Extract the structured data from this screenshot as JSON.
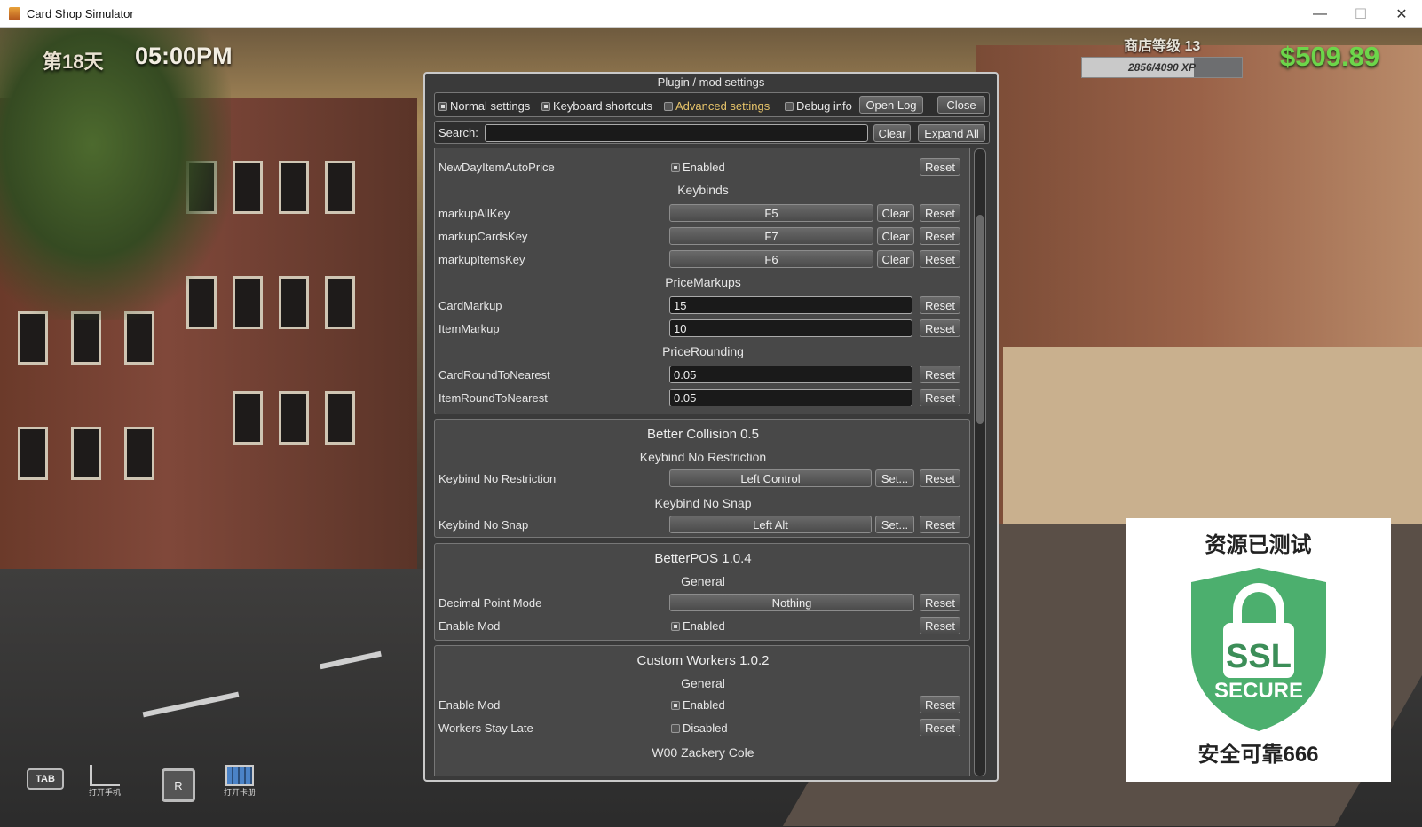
{
  "window": {
    "title": "Card Shop Simulator",
    "minimize": "—",
    "maximize": "☐",
    "close": "✕"
  },
  "hud": {
    "day": "第18天",
    "time": "05:00PM",
    "shop_level": "商店等级 13",
    "xp_text": "2856/4090 XP",
    "xp_fraction": 0.698,
    "money": "$509.89",
    "tab_key": "TAB",
    "phone_label": "打开手机",
    "r_key": "R",
    "album_label": "打开卡册"
  },
  "dialog": {
    "title": "Plugin / mod settings",
    "tabs": [
      {
        "label": "Normal settings",
        "checked": true
      },
      {
        "label": "Keyboard shortcuts",
        "checked": true
      },
      {
        "label": "Advanced settings",
        "checked": false
      },
      {
        "label": "Debug info",
        "checked": false
      }
    ],
    "open_log": "Open Log",
    "close": "Close",
    "search_label": "Search:",
    "search_value": "",
    "clear": "Clear",
    "expand_all": "Expand All",
    "reset": "Reset",
    "set": "Set...",
    "enabled": "Enabled",
    "disabled": "Disabled"
  },
  "settings": {
    "newday": {
      "label": "NewDayItemAutoPrice",
      "value": "Enabled"
    },
    "keybinds": {
      "title": "Keybinds",
      "items": [
        {
          "label": "markupAllKey",
          "value": "F5"
        },
        {
          "label": "markupCardsKey",
          "value": "F7"
        },
        {
          "label": "markupItemsKey",
          "value": "F6"
        }
      ]
    },
    "price_markups": {
      "title": "PriceMarkups",
      "items": [
        {
          "label": "CardMarkup",
          "value": "15"
        },
        {
          "label": "ItemMarkup",
          "value": "10"
        }
      ]
    },
    "price_rounding": {
      "title": "PriceRounding",
      "items": [
        {
          "label": "CardRoundToNearest",
          "value": "0.05"
        },
        {
          "label": "ItemRoundToNearest",
          "value": "0.05"
        }
      ]
    },
    "better_collision": {
      "title": "Better Collision 0.5",
      "sections": [
        {
          "title": "Keybind No Restriction",
          "label": "Keybind No Restriction",
          "value": "Left Control"
        },
        {
          "title": "Keybind No Snap",
          "label": "Keybind No Snap",
          "value": "Left Alt"
        }
      ]
    },
    "better_pos": {
      "title": "BetterPOS 1.0.4",
      "section": "General",
      "decimal_label": "Decimal Point Mode",
      "decimal_value": "Nothing",
      "enable_label": "Enable Mod",
      "enable_value": "Enabled"
    },
    "custom_workers": {
      "title": "Custom Workers 1.0.2",
      "section": "General",
      "enable_label": "Enable Mod",
      "enable_value": "Enabled",
      "stay_late_label": "Workers Stay Late",
      "stay_late_value": "Disabled",
      "next_section": "W00 Zackery Cole"
    }
  },
  "watermark": {
    "top": "资源已测试",
    "shield_top": "SSL",
    "shield_bottom": "SECURE",
    "bottom": "安全可靠666"
  }
}
